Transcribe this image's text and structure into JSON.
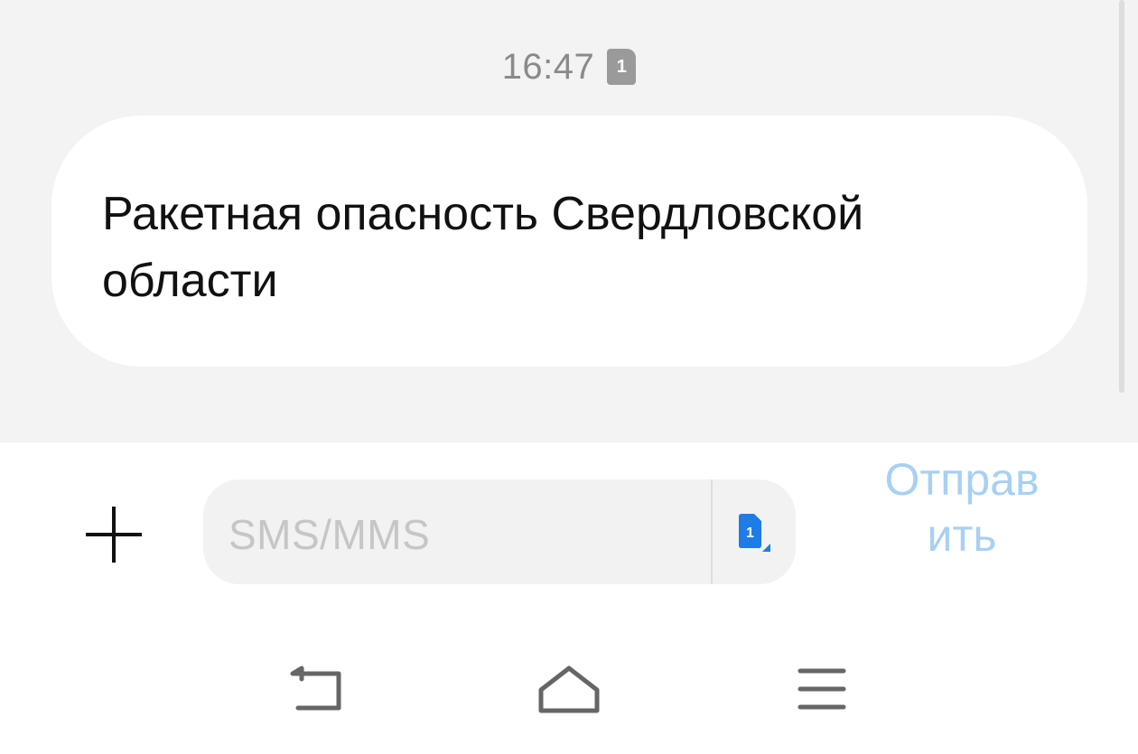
{
  "conversation": {
    "timestamp": "16:47",
    "sim_badge": "1",
    "messages": [
      {
        "text": "Ракетная опасность Свердловской области"
      }
    ]
  },
  "composer": {
    "placeholder": "SMS/MMS",
    "sim_label": "1",
    "send_label": "Отправить",
    "send_line1": "Отправ",
    "send_line2": "ить"
  },
  "navbar": {
    "icons": [
      "back-icon",
      "home-icon",
      "menu-icon"
    ]
  },
  "colors": {
    "chat_background": "#f3f3f3",
    "bubble": "#ffffff",
    "send_disabled": "#a8d0f4",
    "sim_accent": "#1e7ce8"
  }
}
